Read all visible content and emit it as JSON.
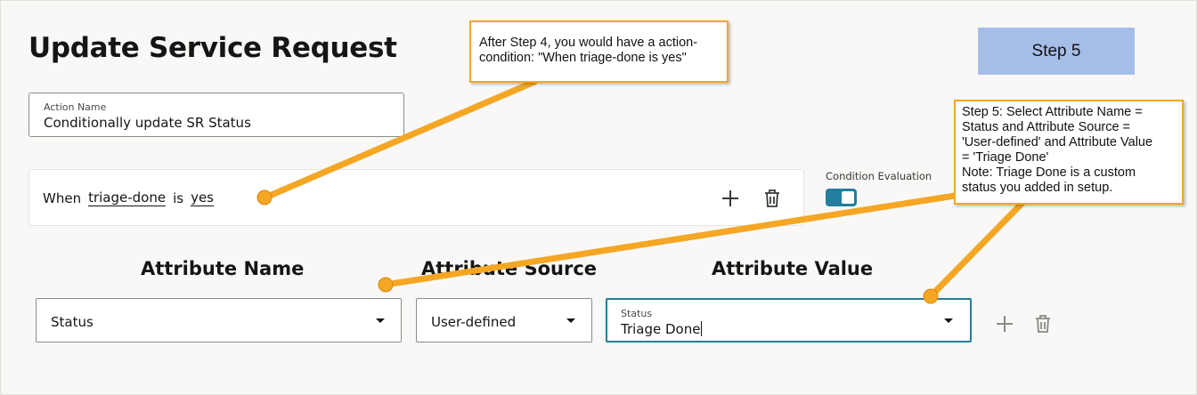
{
  "page": {
    "title": "Update Service Request"
  },
  "step_badge": {
    "label": "Step 5"
  },
  "action_name": {
    "label": "Action Name",
    "value": "Conditionally update SR Status"
  },
  "condition": {
    "when": "When",
    "attribute": "triage-done",
    "operator": "is",
    "value": "yes",
    "add_icon": "plus-icon",
    "delete_icon": "trash-icon"
  },
  "condition_evaluation": {
    "label": "Condition Evaluation",
    "enabled": true
  },
  "columns": {
    "attribute_name": "Attribute Name",
    "attribute_source": "Attribute Source",
    "attribute_value": "Attribute Value"
  },
  "row": {
    "attribute_name": "Status",
    "attribute_source": "User-defined",
    "value_label": "Status",
    "attribute_value": "Triage Done"
  },
  "callouts": {
    "step4_lines": [
      "After Step 4, you would have a action-",
      "condition: \"When triage-done is yes\""
    ],
    "step5_lines": [
      "Step 5: Select Attribute Name =",
      "Status and Attribute Source =",
      "'User-defined' and Attribute Value",
      "= 'Triage Done'",
      "Note: Triage Done is a custom",
      "status you added in setup."
    ]
  },
  "colors": {
    "accent": "#227e9e",
    "callout_border": "#f5a623",
    "leader": "#f5a623",
    "step_badge": "#a6bde8"
  }
}
